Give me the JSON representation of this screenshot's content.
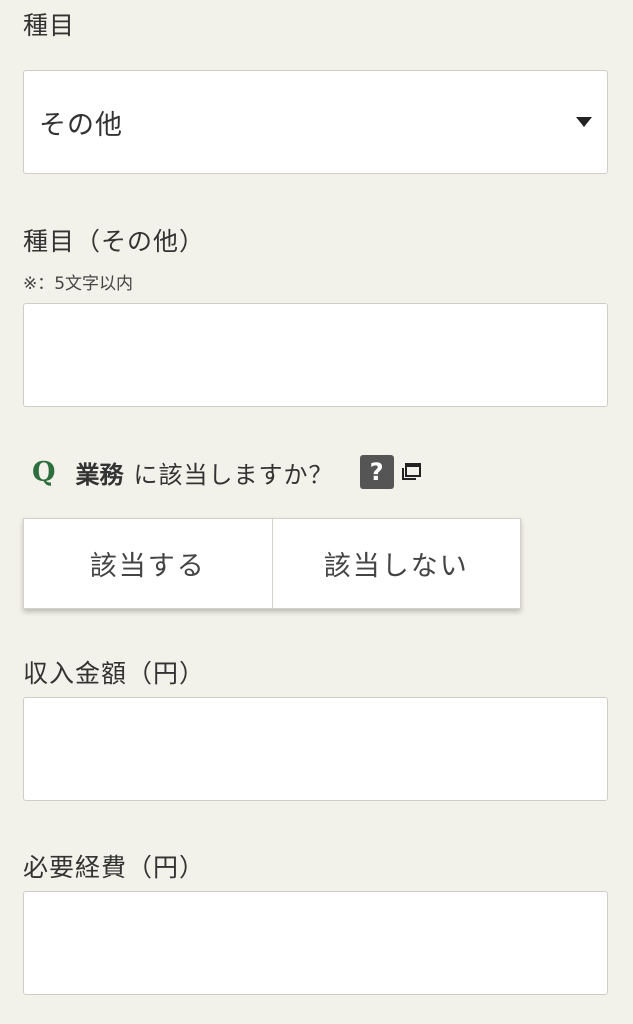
{
  "category": {
    "label": "種目",
    "selected": "その他"
  },
  "category_other": {
    "label": "種目（その他）",
    "note": "※：5文字以内",
    "value": ""
  },
  "question": {
    "q_mark": "Q",
    "keyword": "業務",
    "text": "に該当しますか？",
    "help_label": "?"
  },
  "choices": {
    "yes": "該当する",
    "no": "該当しない"
  },
  "income": {
    "label": "収入金額（円）",
    "value": ""
  },
  "expenses": {
    "label": "必要経費（円）",
    "value": ""
  },
  "colors": {
    "background": "#f3f2ea",
    "accent_q": "#2c6e3c",
    "help_button": "#555555"
  }
}
